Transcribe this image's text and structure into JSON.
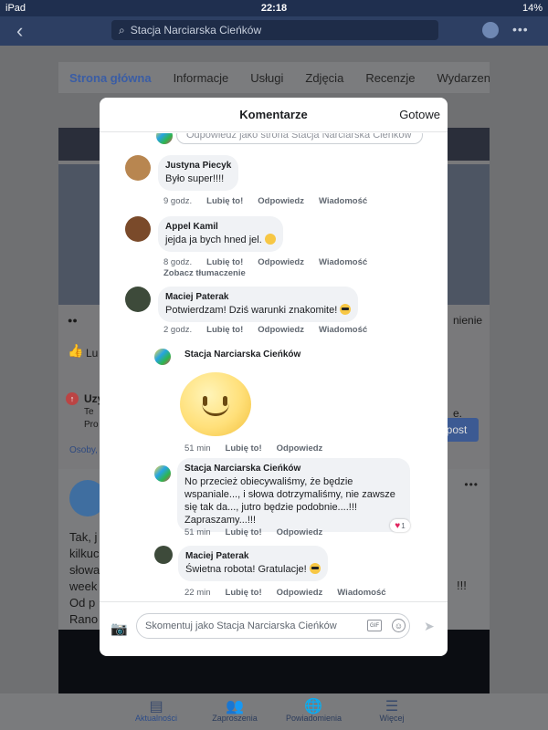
{
  "statusbar": {
    "device": "iPad",
    "time": "22:18",
    "battery": "14%"
  },
  "navbar": {
    "back_icon": "chevron-left-icon",
    "search_text": "Stacja Narciarska Cieńków"
  },
  "tabs": [
    "Strona główna",
    "Informacje",
    "Usługi",
    "Zdjęcia",
    "Recenzje",
    "Wydarzenia"
  ],
  "background": {
    "snippet_u": "Uzy",
    "snippet_te": "Te",
    "snippet_pro": "Pro",
    "snippet_osoby": "Osoby,",
    "snippet_lu": "Lu",
    "snippet_nienie": "nienie",
    "snippet_dot": "e.",
    "post_button": "post",
    "card2_text": [
      "Tak, j",
      "kilkuc",
      "słowa",
      "week",
      "Od p",
      "Rano"
    ],
    "card2_text_right": "!!!"
  },
  "bottombar": [
    {
      "label": "Aktualności",
      "icon": "news-icon"
    },
    {
      "label": "Zaproszenia",
      "icon": "friends-icon"
    },
    {
      "label": "Powiadomienia",
      "icon": "globe-icon"
    },
    {
      "label": "Więcej",
      "icon": "menu-icon"
    }
  ],
  "modal": {
    "title": "Komentarze",
    "done": "Gotowe",
    "reply_hint": "Odpowiedz jako strona Stacja Narciarska Cieńków",
    "comments": [
      {
        "author": "Justyna Piecyk",
        "text": "Było super!!!!",
        "time": "9 godz.",
        "like": "Lubię to!",
        "reply": "Odpowiedz",
        "message": "Wiadomość"
      },
      {
        "author": "Appel Kamil",
        "text": "jejda ja bych hned jel.",
        "time": "8 godz.",
        "like": "Lubię to!",
        "reply": "Odpowiedz",
        "message": "Wiadomość",
        "translate": "Zobacz tłumaczenie"
      },
      {
        "author": "Maciej Paterak",
        "text": "Potwierdzam! Dziś warunki znakomite!",
        "time": "2 godz.",
        "like": "Lubię to!",
        "reply": "Odpowiedz",
        "message": "Wiadomość"
      }
    ],
    "replies": [
      {
        "author": "Stacja Narciarska Cieńków",
        "time": "51 min",
        "like": "Lubię to!",
        "reply": "Odpowiedz"
      },
      {
        "author": "Stacja Narciarska Cieńków",
        "text": "No przecież obiecywaliśmy, że będzie wspaniale..., i słowa dotrzymaliśmy, nie zawsze się tak da..., jutro będzie podobnie....!!! Zapraszamy...!!!",
        "time": "51 min",
        "like": "Lubię to!",
        "reply": "Odpowiedz",
        "reactions": "1"
      },
      {
        "author": "Maciej Paterak",
        "text": "Świetna robota! Gratulacje!",
        "time": "22 min",
        "like": "Lubię to!",
        "reply": "Odpowiedz",
        "message": "Wiadomość"
      }
    ],
    "composer_placeholder": "Skomentuj jako Stacja Narciarska Cieńków",
    "gif_label": "GIF"
  },
  "colors": {
    "accent": "#3a5da5",
    "navbar": "#2d3f63",
    "bubble": "#f0f2f5",
    "heart": "#e0245e"
  }
}
